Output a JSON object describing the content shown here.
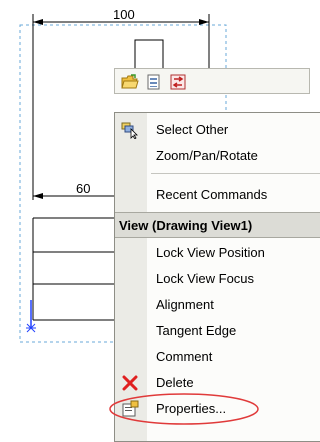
{
  "drawing": {
    "dim_top": "100",
    "dim_left": "60"
  },
  "toolbar": {
    "icons": [
      "folder-open-icon",
      "list-view-icon",
      "swap-icon"
    ]
  },
  "menu": {
    "items_top": [
      {
        "label": "Select Other",
        "icon": "select-other-icon"
      },
      {
        "label": "Zoom/Pan/Rotate"
      },
      {
        "label": "Recent Commands"
      }
    ],
    "header": "View (Drawing View1)",
    "items_view": [
      {
        "label": "Lock View Position"
      },
      {
        "label": "Lock View Focus"
      },
      {
        "label": "Alignment"
      },
      {
        "label": "Tangent Edge"
      },
      {
        "label": "Comment"
      },
      {
        "label": "Delete",
        "icon": "delete-x-icon"
      },
      {
        "label": "Properties...",
        "icon": "properties-icon"
      }
    ]
  },
  "colors": {
    "dashed_border": "#6aa9d8",
    "delete_icon": "#e02020",
    "highlight_ellipse": "#e03a3a",
    "axis_blue": "#2040ff"
  }
}
